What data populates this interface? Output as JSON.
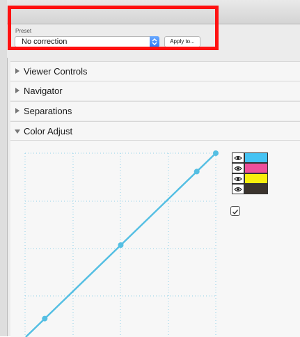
{
  "preset": {
    "label": "Preset",
    "value": "No correction",
    "apply_label": "Apply to..."
  },
  "sections": [
    {
      "label": "Viewer Controls",
      "expanded": false
    },
    {
      "label": "Navigator",
      "expanded": false
    },
    {
      "label": "Separations",
      "expanded": false
    },
    {
      "label": "Color Adjust",
      "expanded": true
    }
  ],
  "separations": [
    {
      "name": "cyan",
      "color": "#45c3f3"
    },
    {
      "name": "magenta",
      "color": "#ee4f9b"
    },
    {
      "name": "yellow",
      "color": "#f8ee0d"
    },
    {
      "name": "black",
      "color": "#3b342e"
    }
  ],
  "curve": {
    "color": "#55bfe3",
    "points": [
      [
        0,
        0
      ],
      [
        0.1,
        0.1
      ],
      [
        0.5,
        0.5
      ],
      [
        0.9,
        0.9
      ],
      [
        1,
        1
      ]
    ]
  },
  "accent": "#ff1111"
}
